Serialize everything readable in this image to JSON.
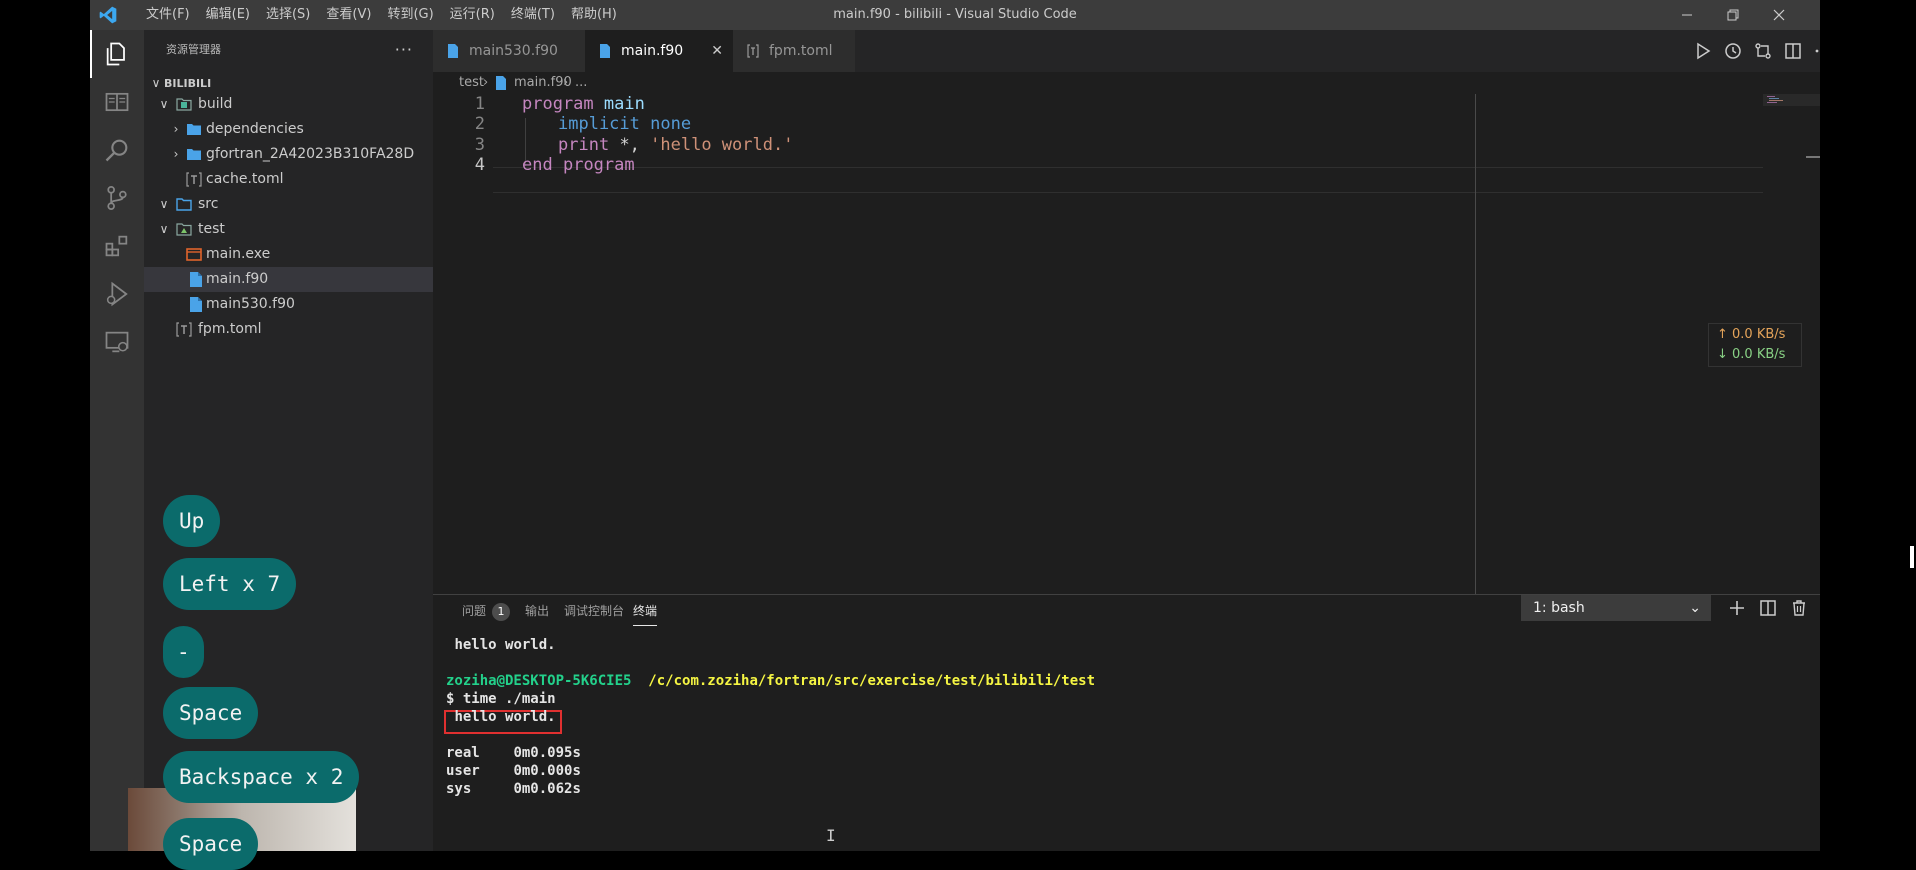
{
  "titlebar": {
    "menus": [
      "文件(F)",
      "编辑(E)",
      "选择(S)",
      "查看(V)",
      "转到(G)",
      "运行(R)",
      "终端(T)",
      "帮助(H)"
    ],
    "window_title": "main.f90 - bilibili - Visual Studio Code"
  },
  "sidebar": {
    "header": "资源管理器",
    "more": "···",
    "root": "BILIBILI",
    "tree": [
      {
        "label": "build",
        "chev": "∨",
        "icon": "folder-build-icon"
      },
      {
        "label": "dependencies",
        "chev": "›",
        "icon": "folder-icon"
      },
      {
        "label": "gfortran_2A42023B310FA28D",
        "chev": "›",
        "icon": "folder-icon"
      },
      {
        "label": "cache.toml",
        "chev": "",
        "icon": "toml-file-icon"
      },
      {
        "label": "src",
        "chev": "∨",
        "icon": "folder-open-icon"
      },
      {
        "label": "test",
        "chev": "∨",
        "icon": "folder-test-icon"
      },
      {
        "label": "main.exe",
        "chev": "",
        "icon": "exe-file-icon"
      },
      {
        "label": "main.f90",
        "chev": "",
        "icon": "fortran-file-icon"
      },
      {
        "label": "main530.f90",
        "chev": "",
        "icon": "fortran-file-icon"
      },
      {
        "label": "fpm.toml",
        "chev": "",
        "icon": "toml-file-icon"
      }
    ]
  },
  "tabs": [
    {
      "label": "main530.f90",
      "active": false
    },
    {
      "label": "main.f90",
      "active": true,
      "close": "✕"
    },
    {
      "label": "fpm.toml",
      "active": false
    }
  ],
  "breadcrumb": {
    "folder": "test",
    "sep": "›",
    "file": "main.f90",
    "more": "..."
  },
  "code": {
    "line_numbers": [
      "1",
      "2",
      "3",
      "4"
    ],
    "l1_kw": "program",
    "l1_name": "main",
    "l2_kw": "implicit",
    "l2_kw2": "none",
    "l3_kw": "print",
    "l3_rest": "*, ",
    "l3_str": "'hello world.'",
    "l4_kw": "end",
    "l4_kw2": "program"
  },
  "net": {
    "up": "↑ 0.0 KB/s",
    "down": "↓ 0.0 KB/s",
    "up_color": "#e5a45a",
    "down_color": "#89d185"
  },
  "panel": {
    "tabs": {
      "problems": "问题",
      "output": "输出",
      "debug_console": "调试控制台",
      "terminal": "终端"
    },
    "problems_count": "1",
    "terminal_select": "1: bash",
    "terminal_lines": {
      "out1": "hello world.",
      "user": "zoziha@DESKTOP-5K6CIE5",
      "path": "/c/com.zoziha/fortran/src/exercise/test/bilibili/test",
      "cmd": "$ time ./main",
      "out2": "hello world.",
      "real": "real\t0m0.095s",
      "user_time": "user\t0m0.000s",
      "sys": "sys\t0m0.062s"
    }
  },
  "keys": [
    "Up",
    "Left x 7",
    "-",
    "Space",
    "Backspace x 2",
    "Space"
  ]
}
